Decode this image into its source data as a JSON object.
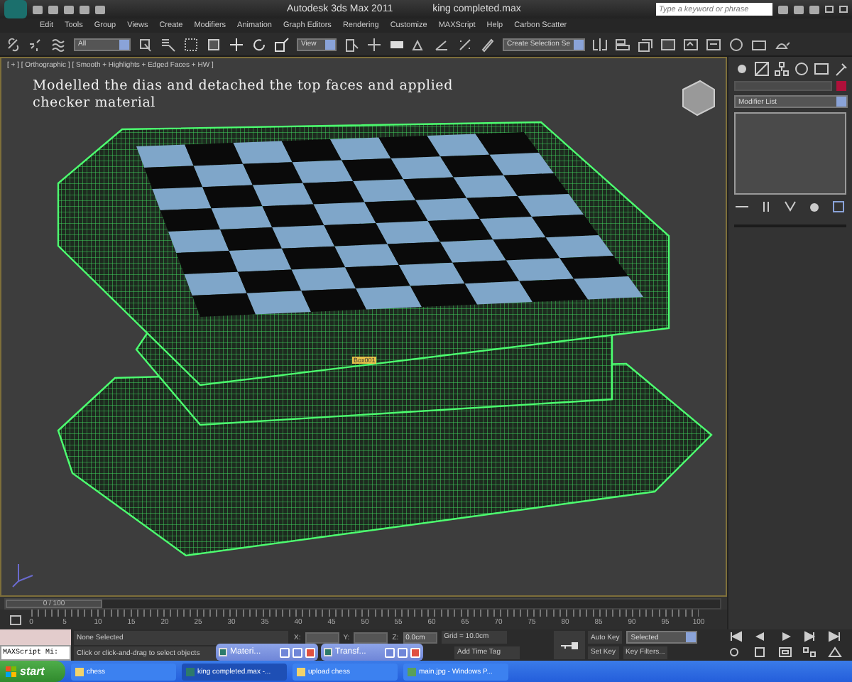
{
  "title_bar": {
    "app_title": "Autodesk 3ds Max  2011",
    "file_name": "king completed.max",
    "search": {
      "placeholder": "Type a keyword or phrase"
    }
  },
  "menu": [
    "Edit",
    "Tools",
    "Group",
    "Views",
    "Create",
    "Modifiers",
    "Animation",
    "Graph Editors",
    "Rendering",
    "Customize",
    "MAXScript",
    "Help",
    "Carbon Scatter"
  ],
  "toolbar": {
    "selection_filter": "All",
    "reference_coord": "View",
    "named_selection": "Create Selection Se"
  },
  "viewport": {
    "label": "[ + ] [ Orthographic ] [ Smooth + Highlights + Edged Faces + HW ]",
    "caption": "Modelled the dias and detached the top faces and applied checker material",
    "object_tag": "Box001"
  },
  "command_panel": {
    "modifier_list": "Modifier List"
  },
  "time_slider": {
    "position": "0 / 100",
    "level": 0
  },
  "trackbar_ticks": [
    "0",
    "5",
    "10",
    "15",
    "20",
    "25",
    "30",
    "35",
    "40",
    "45",
    "50",
    "55",
    "60",
    "65",
    "70",
    "75",
    "80",
    "85",
    "90",
    "95",
    "100"
  ],
  "status": {
    "maxscript": "MAXScript Mi:",
    "selection": "None Selected",
    "prompt": "Click or click-and-drag to select objects",
    "x_label": "X:",
    "y_label": "Y:",
    "z_label": "Z:",
    "z_value": "0.0cm",
    "grid": "Grid = 10.0cm",
    "add_time_tag": "Add Time Tag",
    "auto_key": "Auto Key",
    "key_mode": "Selected",
    "set_key": "Set Key",
    "key_filters": "Key Filters..."
  },
  "floating_windows": [
    {
      "title": "Materi..."
    },
    {
      "title": "Transf..."
    }
  ],
  "taskbar": {
    "start": "start",
    "items": [
      {
        "label": "chess",
        "kind": "folder",
        "selected": false
      },
      {
        "label": "king completed.max -...",
        "kind": "app",
        "selected": true
      },
      {
        "label": "upload chess",
        "kind": "folder",
        "selected": false
      },
      {
        "label": "main.jpg - Windows P...",
        "kind": "image",
        "selected": false
      }
    ]
  }
}
